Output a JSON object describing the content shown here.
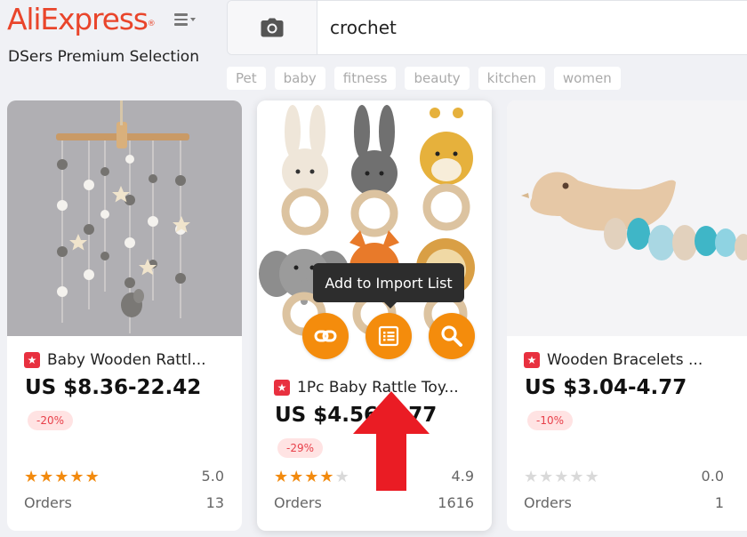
{
  "header": {
    "logo_text": "AliExpress",
    "logo_mark": "®",
    "subtitle": "DSers Premium Selection",
    "menu_icon": "hamburger-menu-icon"
  },
  "search": {
    "value": "crochet",
    "camera_icon": "camera-icon"
  },
  "tags": [
    "Pet",
    "baby",
    "fitness",
    "beauty",
    "kitchen",
    "women"
  ],
  "tooltip": "Add to Import List",
  "products": [
    {
      "title": "Baby Wooden Rattl...",
      "price": "US $8.36-22.42",
      "discount": "-20%",
      "stars": 5,
      "rating": "5.0",
      "orders_label": "Orders",
      "orders": "13"
    },
    {
      "title": "1Pc Baby Rattle Toy...",
      "price": "US $4.56-4.77",
      "discount": "-29%",
      "stars": 4,
      "rating": "4.9",
      "orders_label": "Orders",
      "orders": "1616"
    },
    {
      "title": "Wooden Bracelets ...",
      "price": "US $3.04-4.77",
      "discount": "-10%",
      "stars": 0,
      "rating": "0.0",
      "orders_label": "Orders",
      "orders": "1"
    }
  ],
  "colors": {
    "brand": "#e9452b",
    "action": "#f48c0c",
    "star": "#f28a0e",
    "discount_text": "#e8404a",
    "choice_badge": "#e8303f",
    "arrow": "#ea1c24"
  }
}
